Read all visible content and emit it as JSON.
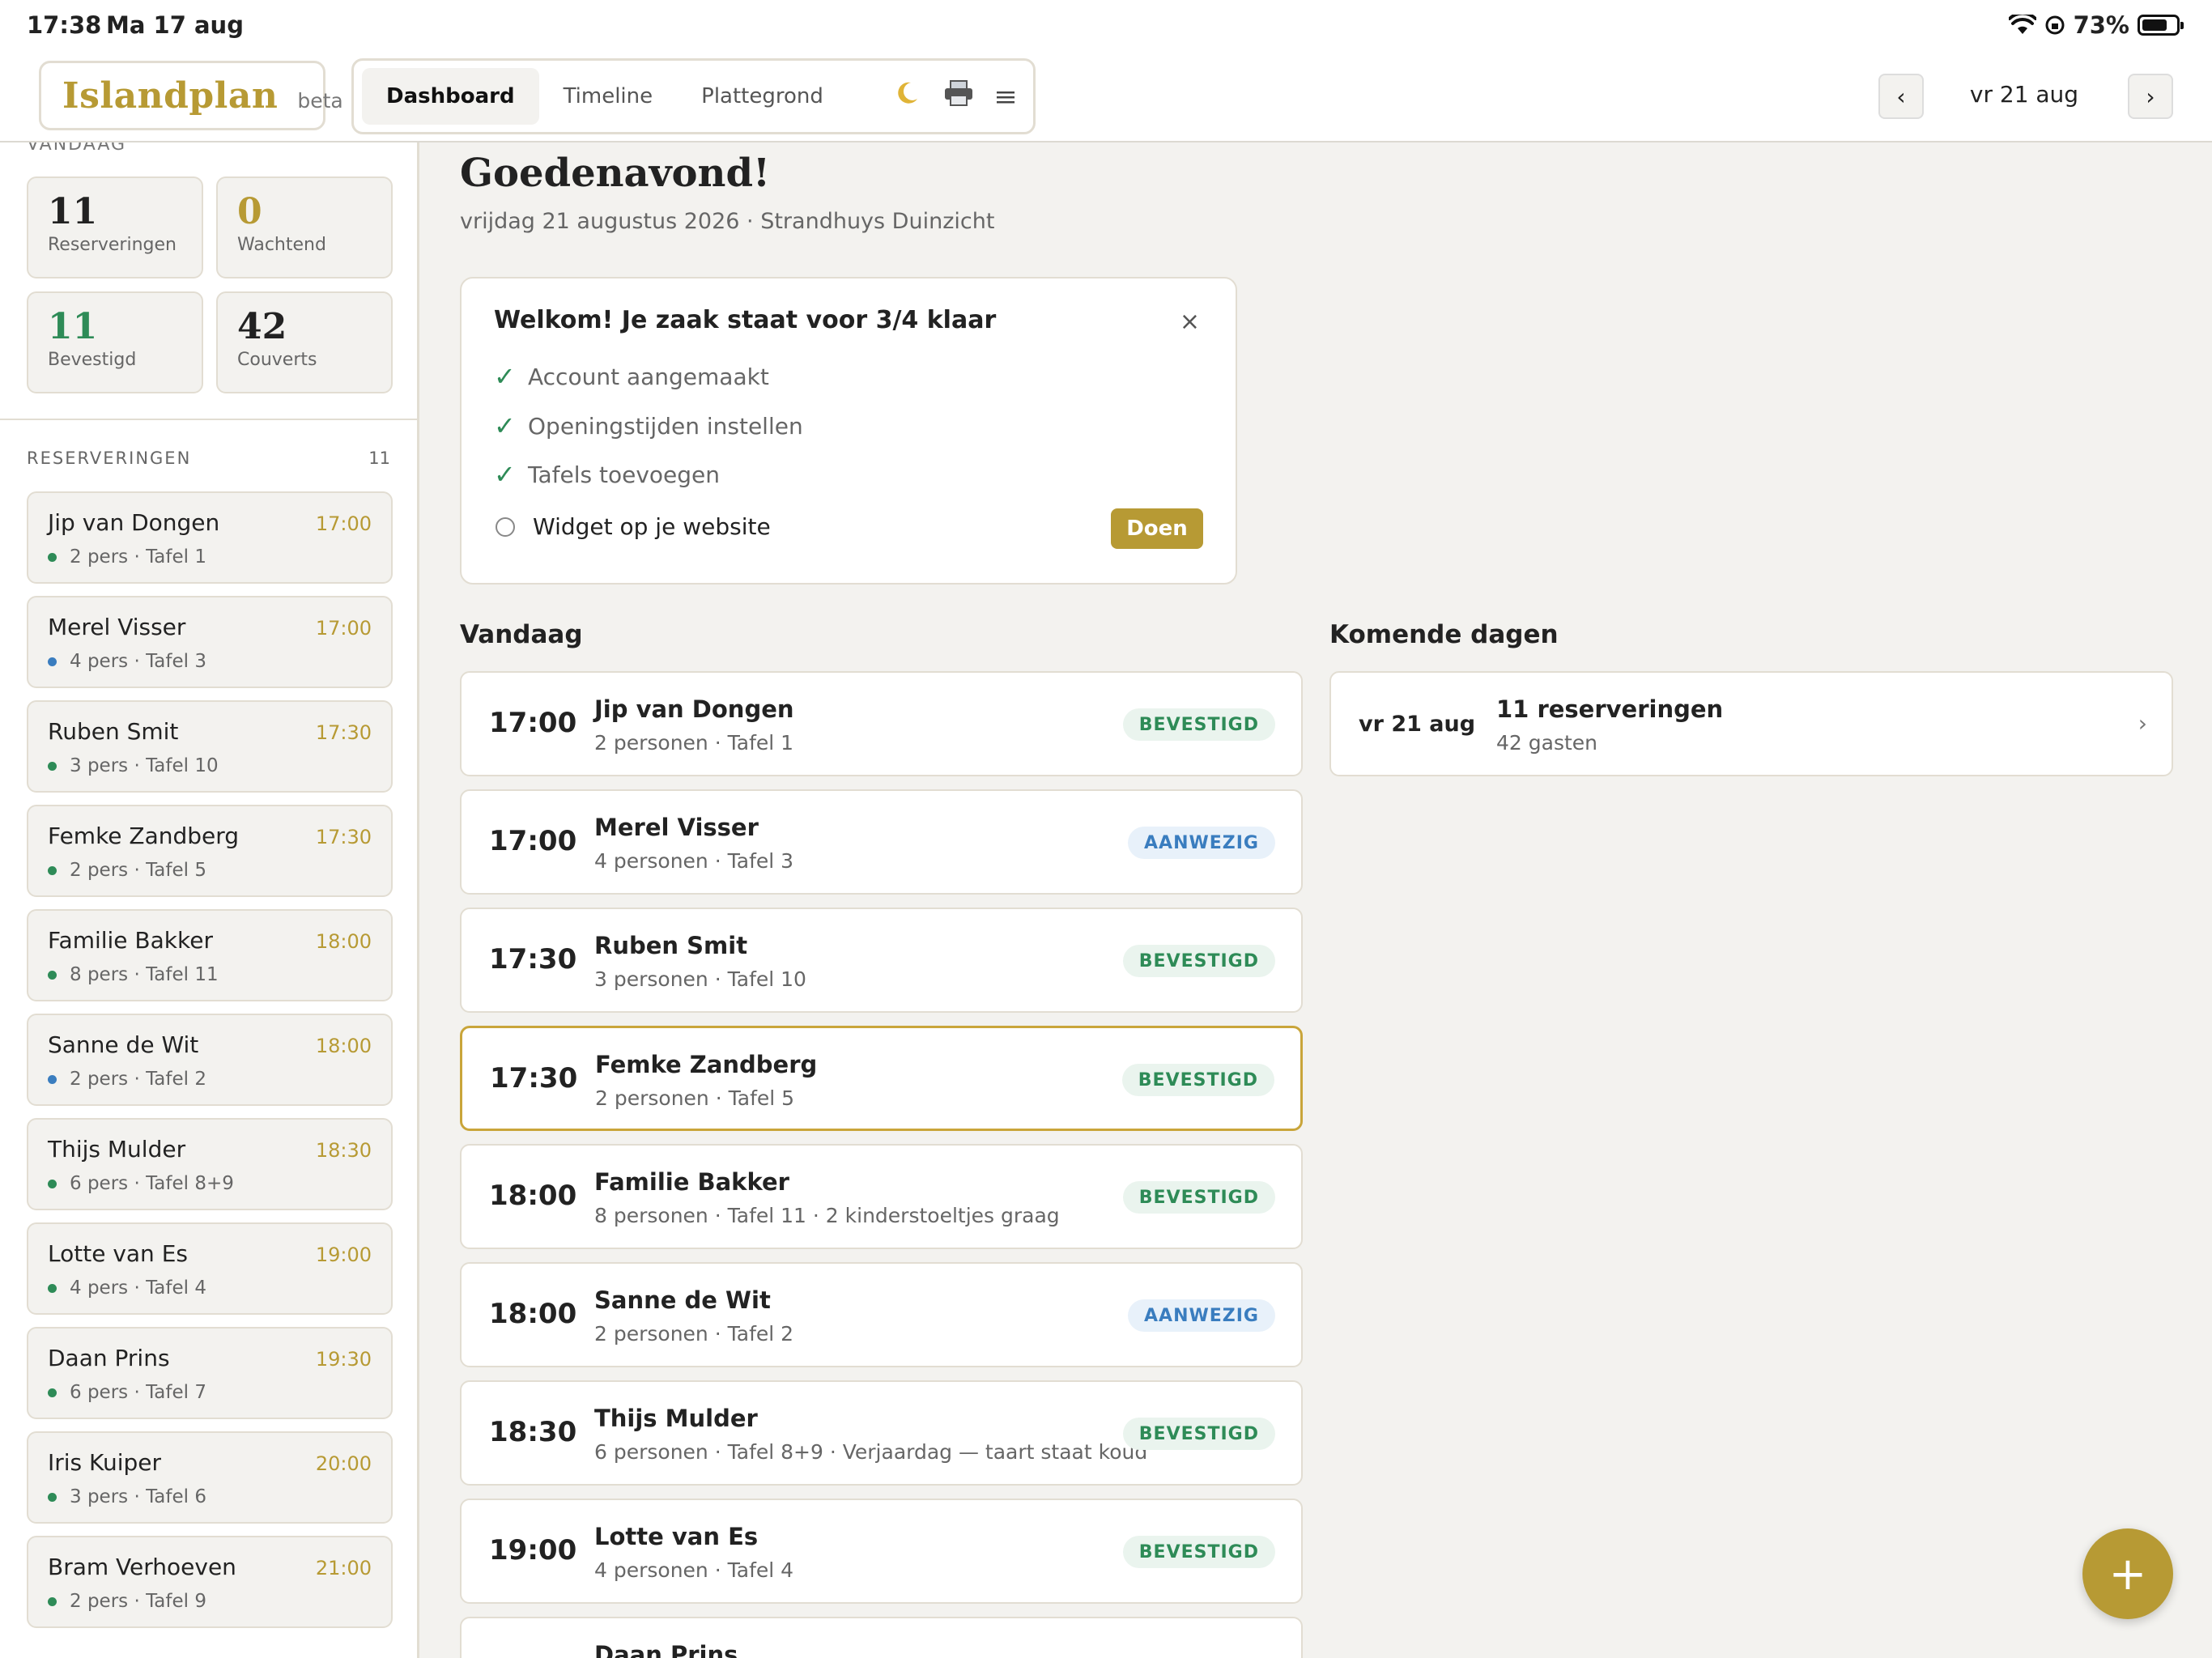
{
  "status_bar": {
    "time": "17:38",
    "date": "Ma 17 aug",
    "battery": "73%"
  },
  "header": {
    "logo": "Islandplan",
    "logo_badge": "beta",
    "tabs": [
      "Dashboard",
      "Timeline",
      "Plattegrond"
    ],
    "active_tab": "Dashboard",
    "icons": [
      "moon-icon",
      "printer-icon",
      "menu-icon"
    ],
    "current_date": "vr 21 aug",
    "prev": "‹",
    "next": "›"
  },
  "sidebar": {
    "today_label": "VANDAAG",
    "stats": [
      {
        "value": "11",
        "label": "Reserveringen",
        "color": "#222222"
      },
      {
        "value": "0",
        "label": "Wachtend",
        "color": "#b79a34"
      },
      {
        "value": "11",
        "label": "Bevestigd",
        "color": "#2e8b57"
      },
      {
        "value": "42",
        "label": "Couverts",
        "color": "#222222"
      }
    ],
    "reservations_label": "RESERVERINGEN",
    "reservations_count": "11",
    "items": [
      {
        "name": "Jip van Dongen",
        "time": "17:00",
        "meta": "2 pers · Tafel 1",
        "dot": "#2e8b57"
      },
      {
        "name": "Merel Visser",
        "time": "17:00",
        "meta": "4 pers · Tafel 3",
        "dot": "#3a7dbf"
      },
      {
        "name": "Ruben Smit",
        "time": "17:30",
        "meta": "3 pers · Tafel 10",
        "dot": "#2e8b57"
      },
      {
        "name": "Femke Zandberg",
        "time": "17:30",
        "meta": "2 pers · Tafel 5",
        "dot": "#2e8b57"
      },
      {
        "name": "Familie Bakker",
        "time": "18:00",
        "meta": "8 pers · Tafel 11",
        "dot": "#2e8b57"
      },
      {
        "name": "Sanne de Wit",
        "time": "18:00",
        "meta": "2 pers · Tafel 2",
        "dot": "#3a7dbf"
      },
      {
        "name": "Thijs Mulder",
        "time": "18:30",
        "meta": "6 pers · Tafel 8+9",
        "dot": "#2e8b57"
      },
      {
        "name": "Lotte van Es",
        "time": "19:00",
        "meta": "4 pers · Tafel 4",
        "dot": "#2e8b57"
      },
      {
        "name": "Daan Prins",
        "time": "19:30",
        "meta": "6 pers · Tafel 7",
        "dot": "#2e8b57"
      },
      {
        "name": "Iris Kuiper",
        "time": "20:00",
        "meta": "3 pers · Tafel 6",
        "dot": "#2e8b57"
      },
      {
        "name": "Bram Verhoeven",
        "time": "21:00",
        "meta": "2 pers · Tafel 9",
        "dot": "#2e8b57"
      }
    ]
  },
  "main": {
    "greeting": "Goedenavond!",
    "subline": "vrijdag 21 augustus 2026 · Strandhuys Duinzicht",
    "welcome": {
      "title": "Welkom! Je zaak staat voor 3/4 klaar",
      "close": "×",
      "steps": [
        {
          "label": "Account aangemaakt",
          "done": true
        },
        {
          "label": "Openingstijden instellen",
          "done": true
        },
        {
          "label": "Tafels toevoegen",
          "done": true
        },
        {
          "label": "Widget op je website",
          "done": false
        }
      ],
      "action_label": "Doen"
    },
    "today_title": "Vandaag",
    "today": [
      {
        "time": "17:00",
        "name": "Jip van Dongen",
        "meta": "2 personen · Tafel 1",
        "status": "BEVESTIGD",
        "status_color": "green"
      },
      {
        "time": "17:00",
        "name": "Merel Visser",
        "meta": "4 personen · Tafel 3",
        "status": "AANWEZIG",
        "status_color": "blue"
      },
      {
        "time": "17:30",
        "name": "Ruben Smit",
        "meta": "3 personen · Tafel 10",
        "status": "BEVESTIGD",
        "status_color": "green"
      },
      {
        "time": "17:30",
        "name": "Femke Zandberg",
        "meta": "2 personen · Tafel 5",
        "status": "BEVESTIGD",
        "status_color": "green",
        "selected": true
      },
      {
        "time": "18:00",
        "name": "Familie Bakker",
        "meta": "8 personen · Tafel 11 · 2 kinderstoeltjes graag",
        "status": "BEVESTIGD",
        "status_color": "green"
      },
      {
        "time": "18:00",
        "name": "Sanne de Wit",
        "meta": "2 personen · Tafel 2",
        "status": "AANWEZIG",
        "status_color": "blue"
      },
      {
        "time": "18:30",
        "name": "Thijs Mulder",
        "meta": "6 personen · Tafel 8+9 · Verjaardag — taart staat koud",
        "status": "BEVESTIGD",
        "status_color": "green"
      },
      {
        "time": "19:00",
        "name": "Lotte van Es",
        "meta": "4 personen · Tafel 4",
        "status": "BEVESTIGD",
        "status_color": "green"
      },
      {
        "time": "",
        "name": "Daan Prins",
        "meta": "",
        "status": "",
        "status_color": "green"
      }
    ],
    "upcoming_title": "Komende dagen",
    "upcoming": [
      {
        "date": "vr 21 aug",
        "count": "11 reserveringen",
        "guests": "42 gasten"
      }
    ],
    "fab_label": "+"
  }
}
